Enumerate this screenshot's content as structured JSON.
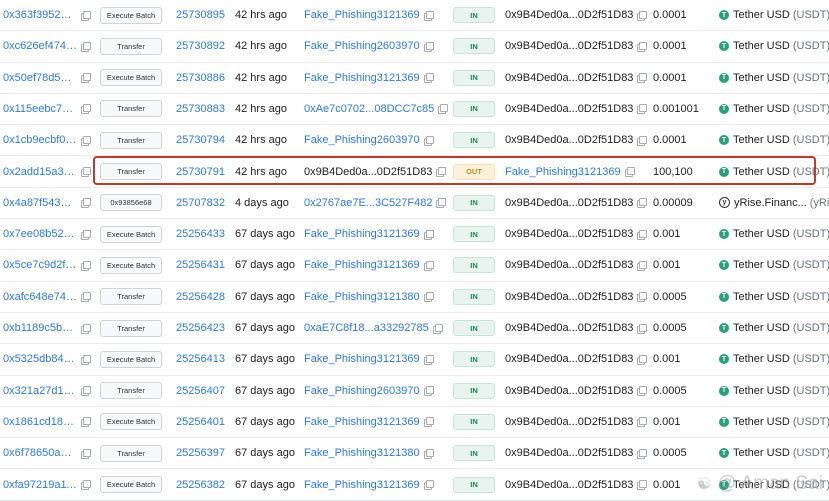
{
  "rows": [
    {
      "hash": "0x363f3952a5a...",
      "method": "Execute Batch",
      "block": "25730895",
      "age": "42 hrs ago",
      "from": "Fake_Phishing3121369",
      "from_link": true,
      "direction": "IN",
      "to": "0x9B4Ded0a...0D2f51D83",
      "to_link": false,
      "value": "0.0001",
      "token": "Tether USD",
      "token_symbol": "(USDT)",
      "token_icon": "tether-icon"
    },
    {
      "hash": "0xc626ef4746f...",
      "method": "Transfer",
      "block": "25730892",
      "age": "42 hrs ago",
      "from": "Fake_Phishing2603970",
      "from_link": true,
      "direction": "IN",
      "to": "0x9B4Ded0a...0D2f51D83",
      "to_link": false,
      "value": "0.0001",
      "token": "Tether USD",
      "token_symbol": "(USDT)",
      "token_icon": "tether-icon"
    },
    {
      "hash": "0x50ef78d5717...",
      "method": "Execute Batch",
      "block": "25730886",
      "age": "42 hrs ago",
      "from": "Fake_Phishing3121369",
      "from_link": true,
      "direction": "IN",
      "to": "0x9B4Ded0a...0D2f51D83",
      "to_link": false,
      "value": "0.0001",
      "token": "Tether USD",
      "token_symbol": "(USDT)",
      "token_icon": "tether-icon"
    },
    {
      "hash": "0x115eebc781...",
      "method": "Transfer",
      "block": "25730883",
      "age": "42 hrs ago",
      "from": "0xAe7c0702...08DCC7c85",
      "from_link": true,
      "direction": "IN",
      "to": "0x9B4Ded0a...0D2f51D83",
      "to_link": false,
      "value": "0.001001",
      "token": "Tether USD",
      "token_symbol": "(USDT)",
      "token_icon": "tether-icon"
    },
    {
      "hash": "0x1cb9ecbf00b...",
      "method": "Transfer",
      "block": "25730794",
      "age": "42 hrs ago",
      "from": "Fake_Phishing2603970",
      "from_link": true,
      "direction": "IN",
      "to": "0x9B4Ded0a...0D2f51D83",
      "to_link": false,
      "value": "0.0001",
      "token": "Tether USD",
      "token_symbol": "(USDT)",
      "token_icon": "tether-icon"
    },
    {
      "hash": "0x2add15a3cc...",
      "method": "Transfer",
      "block": "25730791",
      "age": "42 hrs ago",
      "from": "0x9B4Ded0a...0D2f51D83",
      "from_link": false,
      "direction": "OUT",
      "to": "Fake_Phishing3121369",
      "to_link": true,
      "value": "100,100",
      "token": "Tether USD",
      "token_symbol": "(USDT)",
      "token_icon": "tether-icon"
    },
    {
      "hash": "0x4a87f543b77...",
      "method": "0x93856e68",
      "block": "25707832",
      "age": "4 days ago",
      "from": "0x2767ae7E...3C527F482",
      "from_link": true,
      "direction": "IN",
      "to": "0x9B4Ded0a...0D2f51D83",
      "to_link": false,
      "value": "0.00009",
      "token": "yRise.Financ...",
      "token_symbol": "(yRise)",
      "token_icon": "yrise-icon"
    },
    {
      "hash": "0x7ee08b5217f...",
      "method": "Execute Batch",
      "block": "25256433",
      "age": "67 days ago",
      "from": "Fake_Phishing3121369",
      "from_link": true,
      "direction": "IN",
      "to": "0x9B4Ded0a...0D2f51D83",
      "to_link": false,
      "value": "0.001",
      "token": "Tether USD",
      "token_symbol": "(USDT)",
      "token_icon": "tether-icon"
    },
    {
      "hash": "0x5ce7c9d2fe8...",
      "method": "Execute Batch",
      "block": "25256431",
      "age": "67 days ago",
      "from": "Fake_Phishing3121369",
      "from_link": true,
      "direction": "IN",
      "to": "0x9B4Ded0a...0D2f51D83",
      "to_link": false,
      "value": "0.001",
      "token": "Tether USD",
      "token_symbol": "(USDT)",
      "token_icon": "tether-icon"
    },
    {
      "hash": "0xafc648e74ad...",
      "method": "Transfer",
      "block": "25256428",
      "age": "67 days ago",
      "from": "Fake_Phishing3121380",
      "from_link": true,
      "direction": "IN",
      "to": "0x9B4Ded0a...0D2f51D83",
      "to_link": false,
      "value": "0.0005",
      "token": "Tether USD",
      "token_symbol": "(USDT)",
      "token_icon": "tether-icon"
    },
    {
      "hash": "0xb1189c5b9b...",
      "method": "Transfer",
      "block": "25256423",
      "age": "67 days ago",
      "from": "0xaE7C8f18...a33292785",
      "from_link": true,
      "direction": "IN",
      "to": "0x9B4Ded0a...0D2f51D83",
      "to_link": false,
      "value": "0.0005",
      "token": "Tether USD",
      "token_symbol": "(USDT)",
      "token_icon": "tether-icon"
    },
    {
      "hash": "0x5325db84c2...",
      "method": "Execute Batch",
      "block": "25256413",
      "age": "67 days ago",
      "from": "Fake_Phishing3121369",
      "from_link": true,
      "direction": "IN",
      "to": "0x9B4Ded0a...0D2f51D83",
      "to_link": false,
      "value": "0.001",
      "token": "Tether USD",
      "token_symbol": "(USDT)",
      "token_icon": "tether-icon"
    },
    {
      "hash": "0x321a27d190...",
      "method": "Transfer",
      "block": "25256407",
      "age": "67 days ago",
      "from": "Fake_Phishing2603970",
      "from_link": true,
      "direction": "IN",
      "to": "0x9B4Ded0a...0D2f51D83",
      "to_link": false,
      "value": "0.0005",
      "token": "Tether USD",
      "token_symbol": "(USDT)",
      "token_icon": "tether-icon"
    },
    {
      "hash": "0x1861cd185cf...",
      "method": "Execute Batch",
      "block": "25256401",
      "age": "67 days ago",
      "from": "Fake_Phishing3121369",
      "from_link": true,
      "direction": "IN",
      "to": "0x9B4Ded0a...0D2f51D83",
      "to_link": false,
      "value": "0.001",
      "token": "Tether USD",
      "token_symbol": "(USDT)",
      "token_icon": "tether-icon"
    },
    {
      "hash": "0x6f78650aef8...",
      "method": "Transfer",
      "block": "25256397",
      "age": "67 days ago",
      "from": "Fake_Phishing3121380",
      "from_link": true,
      "direction": "IN",
      "to": "0x9B4Ded0a...0D2f51D83",
      "to_link": false,
      "value": "0.0005",
      "token": "Tether USD",
      "token_symbol": "(USDT)",
      "token_icon": "tether-icon"
    },
    {
      "hash": "0xfa97219a111...",
      "method": "Execute Batch",
      "block": "25256382",
      "age": "67 days ago",
      "from": "Fake_Phishing3121369",
      "from_link": true,
      "direction": "IN",
      "to": "0x9B4Ded0a...0D2f51D83",
      "to_link": false,
      "value": "0.001",
      "token": "Tether USD",
      "token_symbol": "(USDT)",
      "token_icon": "tether-icon"
    }
  ],
  "highlighted_row": 5,
  "watermark": {
    "text": "@ Aman Sai",
    "icon": "wechat-icon"
  },
  "colors": {
    "link": "#2c7be5",
    "in_badge": "#1a8754",
    "out_badge": "#c58a1c",
    "tether": "#26a17b",
    "highlight": "#c0392b"
  }
}
